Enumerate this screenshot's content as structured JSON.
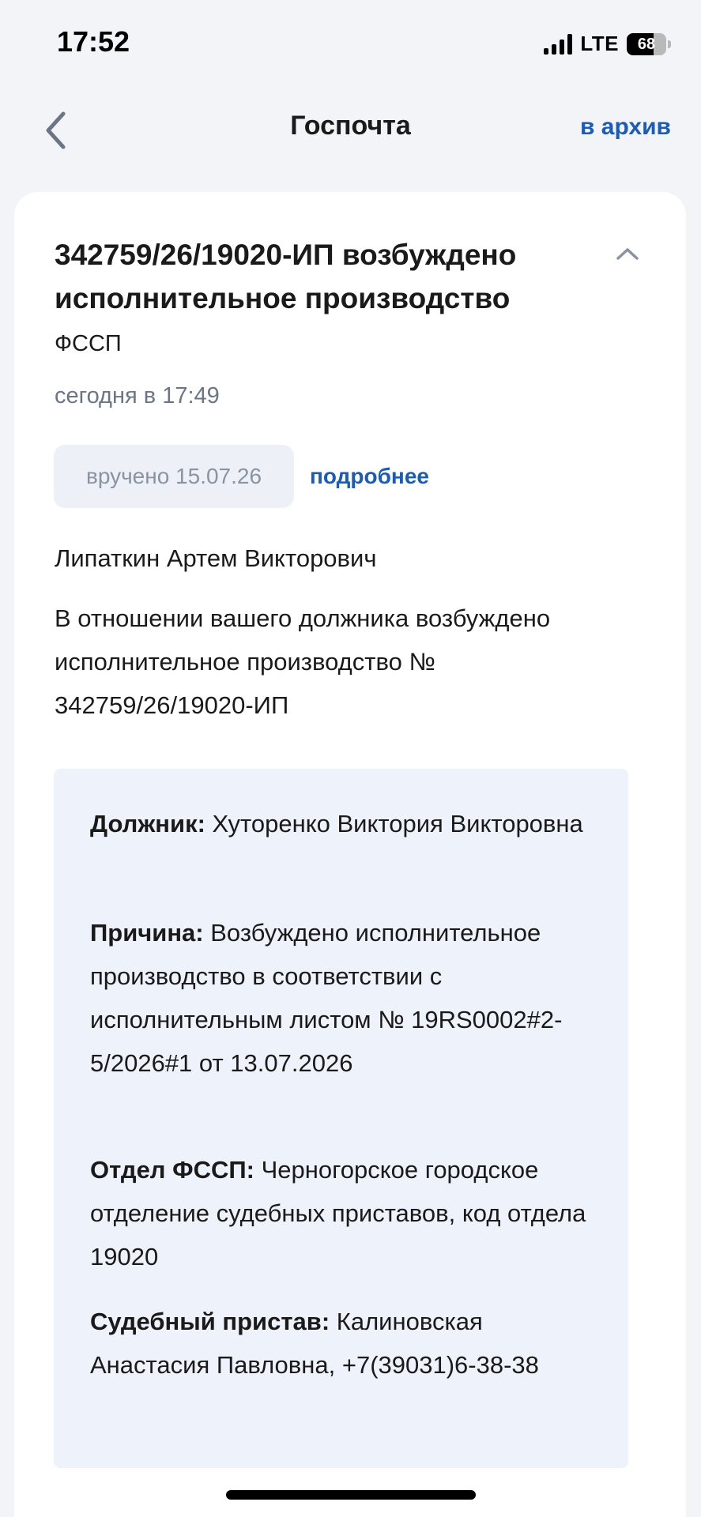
{
  "status_bar": {
    "time": "17:52",
    "network": "LTE",
    "battery_level": 68,
    "battery_text": "68"
  },
  "nav": {
    "title": "Госпочта",
    "archive_label": "в архив"
  },
  "message": {
    "title": "342759/26/19020-ИП возбуждено исполнительное производство",
    "sender": "ФССП",
    "date": "сегодня в 17:49",
    "delivered_label": "вручено 15.07.26",
    "details_label": "подробнее",
    "recipient": "Липаткин Артем Викторович",
    "body": "В отношении вашего должника возбуждено исполнительное производство № 342759/26/19020-ИП"
  },
  "info": {
    "debtor_label": "Должник:",
    "debtor_value": "Хуторенко Виктория Викторовна",
    "reason_label": "Причина:",
    "reason_value": "Возбуждено исполнительное производство в соответствии с исполнительным листом № 19RS0002#2-5/2026#1 от 13.07.2026",
    "dept_label": "Отдел ФССП:",
    "dept_value": "Черногорское городское отделение судебных приставов, код отдела 19020",
    "bailiff_label": "Судебный пристав:",
    "bailiff_value": "Калиновская Анастасия Павловна, +7(39031)6-38-38"
  },
  "colors": {
    "accent": "#1b5cb8",
    "info_background": "#edf2fb",
    "page_background": "#f2f4f7"
  }
}
